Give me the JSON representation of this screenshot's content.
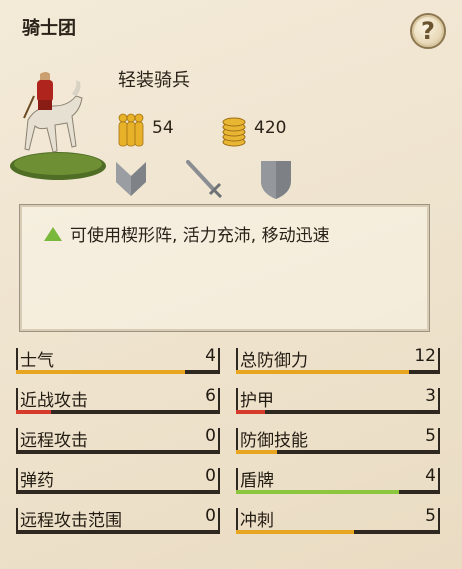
{
  "header": {
    "title": "骑士团",
    "help_label": "?"
  },
  "unit": {
    "name": "轻装骑兵",
    "men": "54",
    "cost": "420"
  },
  "attributes_icons": [
    "chevron-shield-icon",
    "sword-icon",
    "shield-icon"
  ],
  "description": {
    "text": "可使用楔形阵, 活力充沛, 移动迅速",
    "marker": "green-triangle-icon"
  },
  "colors": {
    "orange": "#e8a51f",
    "red": "#d63a2a",
    "green": "#8cc63f",
    "track": "#2e2820"
  },
  "stats_left": [
    {
      "label": "士气",
      "value": "4",
      "fill": 0.83,
      "color": "orange"
    },
    {
      "label": "近战攻击",
      "value": "6",
      "fill": 0.17,
      "color": "red"
    },
    {
      "label": "远程攻击",
      "value": "0",
      "fill": 0,
      "color": "orange"
    },
    {
      "label": "弹药",
      "value": "0",
      "fill": 0,
      "color": "orange"
    },
    {
      "label": "远程攻击范围",
      "value": "0",
      "fill": 0,
      "color": "orange"
    }
  ],
  "stats_right": [
    {
      "label": "总防御力",
      "value": "12",
      "fill": 0.85,
      "color": "orange"
    },
    {
      "label": "护甲",
      "value": "3",
      "fill": 0.14,
      "color": "red"
    },
    {
      "label": "防御技能",
      "value": "5",
      "fill": 0.2,
      "color": "orange"
    },
    {
      "label": "盾牌",
      "value": "4",
      "fill": 0.8,
      "color": "green"
    },
    {
      "label": "冲刺",
      "value": "5",
      "fill": 0.58,
      "color": "orange"
    }
  ]
}
